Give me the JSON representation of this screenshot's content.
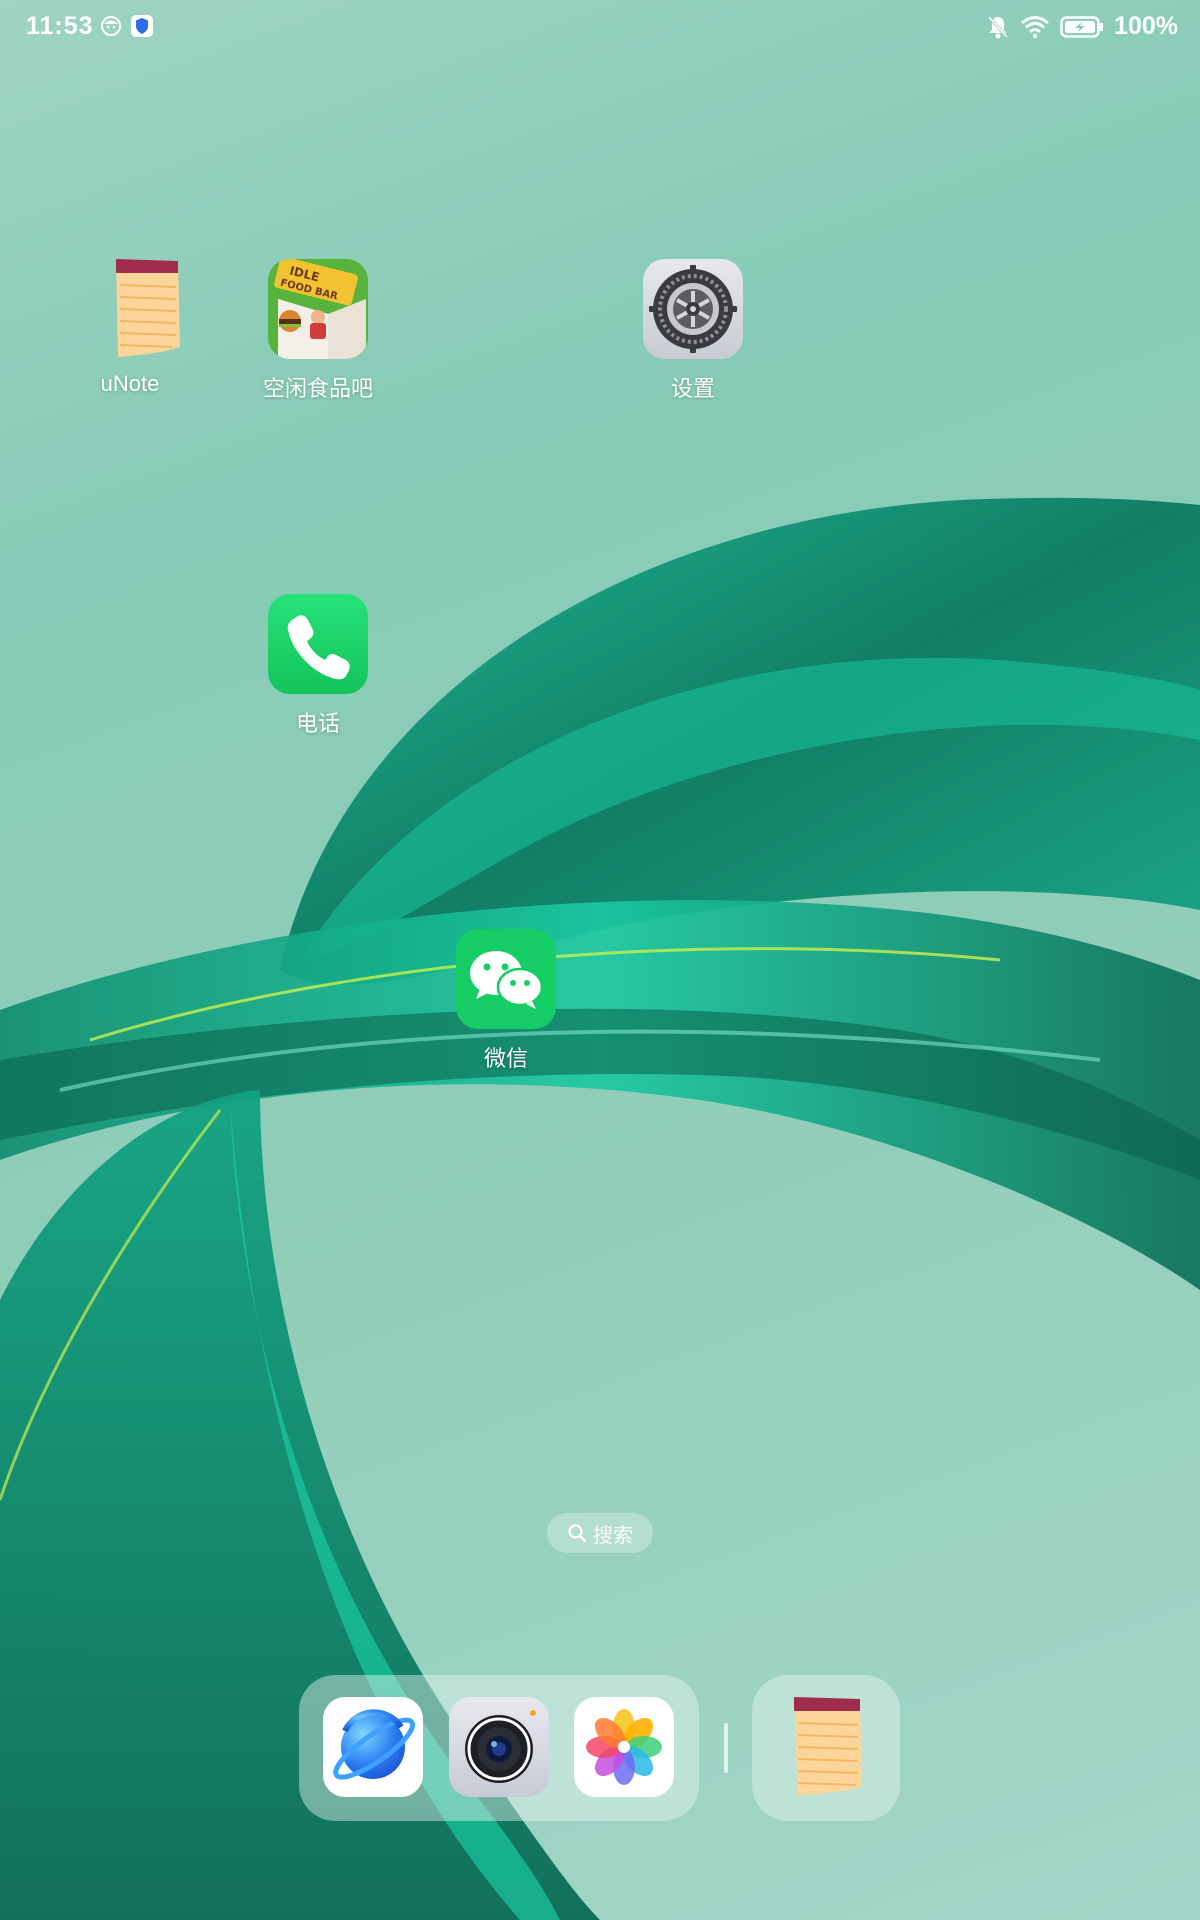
{
  "status_bar": {
    "time": "11:53",
    "battery": "100%",
    "left_icons": [
      "face-icon",
      "shield-icon"
    ],
    "right_icons": [
      "bell-off-icon",
      "wifi-icon",
      "battery-charging-icon"
    ]
  },
  "home": {
    "apps": [
      {
        "label": "uNote",
        "icon": "notepad-icon"
      },
      {
        "label": "空闲食品吧",
        "icon": "idle-food-bar-icon",
        "icon_text": "IDLE FOOD BAR"
      },
      {
        "label": "设置",
        "icon": "settings-gear-icon"
      },
      {
        "label": "电话",
        "icon": "phone-icon"
      },
      {
        "label": "微信",
        "icon": "wechat-icon"
      }
    ]
  },
  "search": {
    "label": "搜索",
    "icon": "search-icon"
  },
  "dock": {
    "apps": [
      {
        "name": "browser",
        "icon": "planet-browser-icon"
      },
      {
        "name": "camera",
        "icon": "camera-icon"
      },
      {
        "name": "gallery",
        "icon": "photos-flower-icon"
      }
    ],
    "recent": {
      "name": "uNote",
      "icon": "notepad-icon"
    }
  },
  "colors": {
    "phone_green": "#1ed760",
    "wechat_green": "#07c160",
    "wallpaper_teal": "#0f8f72"
  }
}
